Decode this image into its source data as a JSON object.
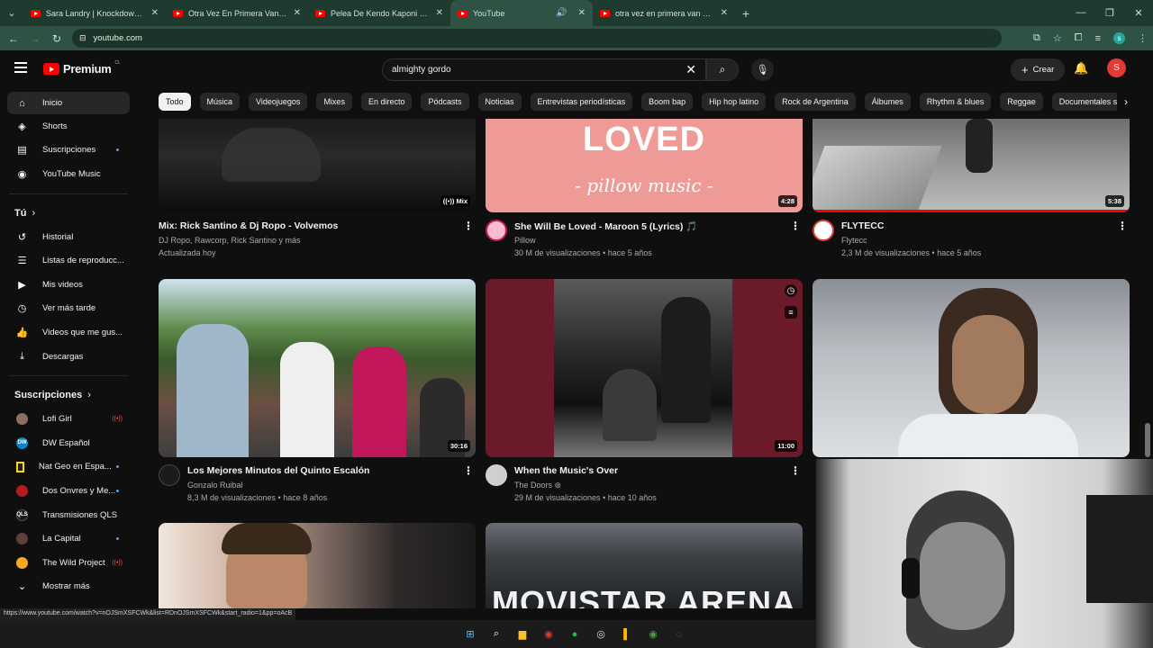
{
  "browser": {
    "tabs": [
      {
        "title": "Sara Landry | Knockdown Cente",
        "active": false
      },
      {
        "title": "Otra Vez En Primera Van A Ver",
        "active": false
      },
      {
        "title": "Pelea De Kendo Kaponi Vs Arca",
        "active": false
      },
      {
        "title": "YouTube",
        "active": true
      },
      {
        "title": "otra vez en primera van a ver a",
        "active": false
      }
    ],
    "url": "youtube.com",
    "status_url": "https://www.youtube.com/watch?v=nOJSmXSFCWk&list=RDnOJSmXSFCWk&start_radio=1&pp=oAcB"
  },
  "header": {
    "logo_text": "Premium",
    "logo_country": "CL",
    "search_value": "almighty gordo",
    "create_label": "Crear",
    "avatar_letter": "S"
  },
  "sidebar": {
    "main": [
      {
        "label": "Inicio",
        "icon": "home-icon",
        "glyph": "⌂",
        "active": true
      },
      {
        "label": "Shorts",
        "icon": "shorts-icon",
        "glyph": "◈"
      },
      {
        "label": "Suscripciones",
        "icon": "subscriptions-icon",
        "glyph": "▤",
        "dot": true
      },
      {
        "label": "YouTube Music",
        "icon": "music-icon",
        "glyph": "◉"
      }
    ],
    "you_heading": "Tú",
    "you": [
      {
        "label": "Historial",
        "icon": "history-icon",
        "glyph": "↺"
      },
      {
        "label": "Listas de reproducc...",
        "icon": "playlists-icon",
        "glyph": "☰"
      },
      {
        "label": "Mis videos",
        "icon": "my-videos-icon",
        "glyph": "▶"
      },
      {
        "label": "Ver más tarde",
        "icon": "watch-later-icon",
        "glyph": "◷"
      },
      {
        "label": "Videos que me gus...",
        "icon": "liked-icon",
        "glyph": "👍"
      },
      {
        "label": "Descargas",
        "icon": "downloads-icon",
        "glyph": "⤓"
      }
    ],
    "subs_heading": "Suscripciones",
    "subs": [
      {
        "label": "Lofi Girl",
        "color": "#8d6e63",
        "mark": "",
        "live": true
      },
      {
        "label": "DW Español",
        "color": "#0288d1",
        "mark": "DW",
        "live": false
      },
      {
        "label": "Nat Geo en Espa...",
        "color": "#212121",
        "mark": "",
        "live": false,
        "dot": true
      },
      {
        "label": "Dos Onvres y Me...",
        "color": "#6d4c41",
        "mark": "",
        "live": false,
        "dot": true
      },
      {
        "label": "Transmisiones QLS",
        "color": "#1a1a1a",
        "mark": "QLS",
        "live": false
      },
      {
        "label": "La Capital",
        "color": "#4e342e",
        "mark": "",
        "live": false,
        "dot": true
      },
      {
        "label": "The Wild Project",
        "color": "#f9a825",
        "mark": "",
        "live": true
      }
    ],
    "more_label": "Mostrar más"
  },
  "chips": [
    "Todo",
    "Música",
    "Videojuegos",
    "Mixes",
    "En directo",
    "Pódcasts",
    "Noticias",
    "Entrevistas periodísticas",
    "Boom bap",
    "Hip hop latino",
    "Rock de Argentina",
    "Álbumes",
    "Rhythm & blues",
    "Reggae",
    "Documentales s"
  ],
  "videos": [
    {
      "title": "Mix: Rick Santino & Dj Ropo - Volvemos",
      "channel": "DJ Ropo, Rawcorp, Rick Santino y más",
      "stats": "Actualizada hoy",
      "duration": "Mix",
      "avatar": false
    },
    {
      "title": "She Will Be Loved - Maroon 5 (Lyrics) 🎵",
      "channel": "Pillow",
      "stats": "30 M de visualizaciones • hace 5 años",
      "duration": "4:28",
      "thumb_text_1": "LOVED",
      "thumb_text_2": "- pillow music -",
      "avatar": true
    },
    {
      "title": "FLYTECC",
      "channel": "Flytecc",
      "stats": "2,3 M de visualizaciones • hace 5 años",
      "duration": "5:38",
      "avatar": true
    },
    {
      "title": "Los Mejores Minutos del Quinto Escalón",
      "channel": "Gonzalo Ruibal",
      "stats": "8,3 M de visualizaciones • hace 8 años",
      "duration": "30:16",
      "avatar": true
    },
    {
      "title": "When the Music's Over",
      "channel": "The Doors ⊛",
      "stats": "29 M de visualizaciones • hace 10 años",
      "duration": "11:00",
      "avatar": true
    },
    {
      "title": "",
      "channel": "",
      "stats": "",
      "duration": "",
      "avatar": false
    },
    {
      "title": "",
      "channel": "",
      "stats": "",
      "duration": "",
      "avatar": false
    },
    {
      "title": "",
      "channel": "",
      "stats": "",
      "duration": "",
      "thumb_text_1": "MOVISTAR ARENA",
      "avatar": false
    }
  ],
  "colors": {
    "yt_red": "#ff0000",
    "bg": "#0f0f0f",
    "chrome_green": "#2e5243"
  }
}
